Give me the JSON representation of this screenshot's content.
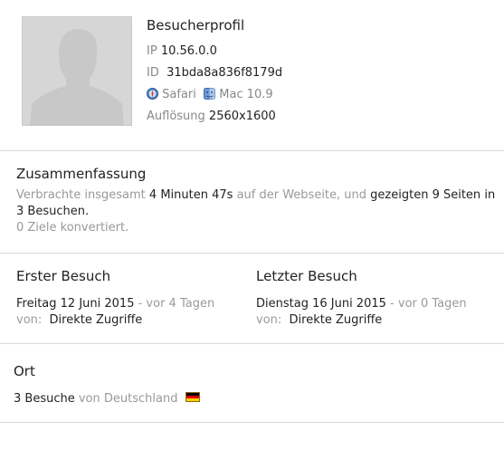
{
  "profile": {
    "title": "Besucherprofil",
    "ip_label": "IP",
    "ip_value": "10.56.0.0",
    "id_label": "ID",
    "id_value": "31bda8a836f8179d",
    "browser": "Safari",
    "browser_icon": "safari-icon",
    "os": "Mac 10.9",
    "os_icon": "mac-finder-icon",
    "resolution_label": "Auflösung",
    "resolution_value": "2560x1600"
  },
  "summary": {
    "title": "Zusammenfassung",
    "t1": "Verbrachte insgesamt",
    "time": "4 Minuten 47s",
    "t2": "auf der Webseite, und",
    "shown": "gezeigten 9 Seiten",
    "t3": "in",
    "visits": "3 Besuchen.",
    "goals": "0 Ziele konvertiert."
  },
  "first_visit": {
    "title": "Erster Besuch",
    "date": "Freitag 12 Juni 2015",
    "ago": "- vor 4 Tagen",
    "from_label": "von:",
    "source": "Direkte Zugriffe"
  },
  "last_visit": {
    "title": "Letzter Besuch",
    "date": "Dienstag 16 Juni 2015",
    "ago": "- vor 0 Tagen",
    "from_label": "von:",
    "source": "Direkte Zugriffe"
  },
  "location": {
    "title": "Ort",
    "visits": "3 Besuche",
    "from": "von Deutschland",
    "flag_icon": "germany-flag-icon",
    "flag_colors": [
      "#000000",
      "#dd0000",
      "#ffce00"
    ]
  }
}
